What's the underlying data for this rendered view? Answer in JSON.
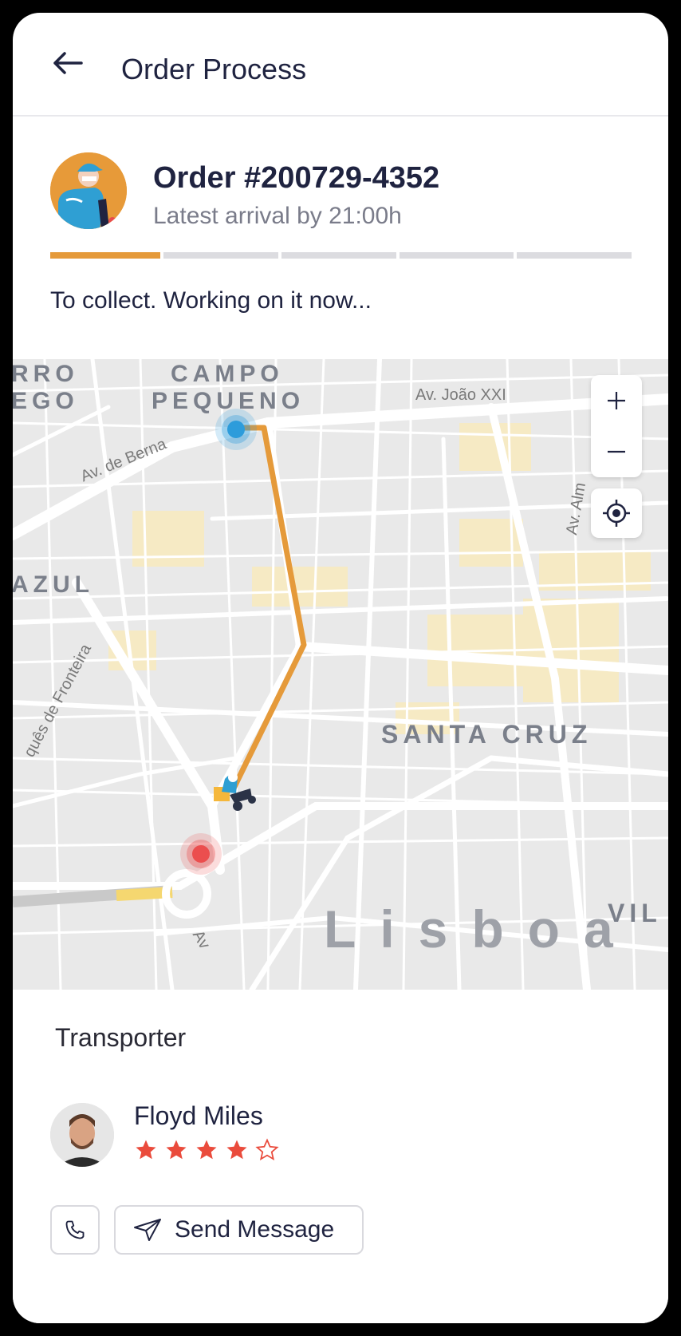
{
  "header": {
    "title": "Order Process"
  },
  "order": {
    "number": "Order #200729-4352",
    "arrival": "Latest arrival by 21:00h",
    "status": "To collect. Working on it now...",
    "progress_steps_total": 5,
    "progress_steps_done": 1
  },
  "map": {
    "labels": {
      "campo": "CAMPO",
      "pequeno": "PEQUENO",
      "rro": "RRO",
      "ego": "EGO",
      "azul": "AZUL",
      "santa_cruz": "SANTA CRUZ",
      "lisboa": "Lisboa",
      "vil": "VIL"
    },
    "streets": {
      "joao": "Av. João XXI",
      "berna": "Av. de Berna",
      "fronteira": "quês de Fronteira",
      "av_bottom": "Av",
      "av_right": "Av. Alm"
    },
    "colors": {
      "route": "#e59a3a",
      "origin": "#2d9cdb",
      "destination": "#eb4e4e"
    }
  },
  "transporter": {
    "heading": "Transporter",
    "name": "Floyd Miles",
    "rating": 4,
    "rating_max": 5,
    "send_message_label": "Send Message"
  },
  "colors": {
    "accent": "#e59a3a",
    "text": "#1f2340",
    "star": "#ea4b3c"
  }
}
